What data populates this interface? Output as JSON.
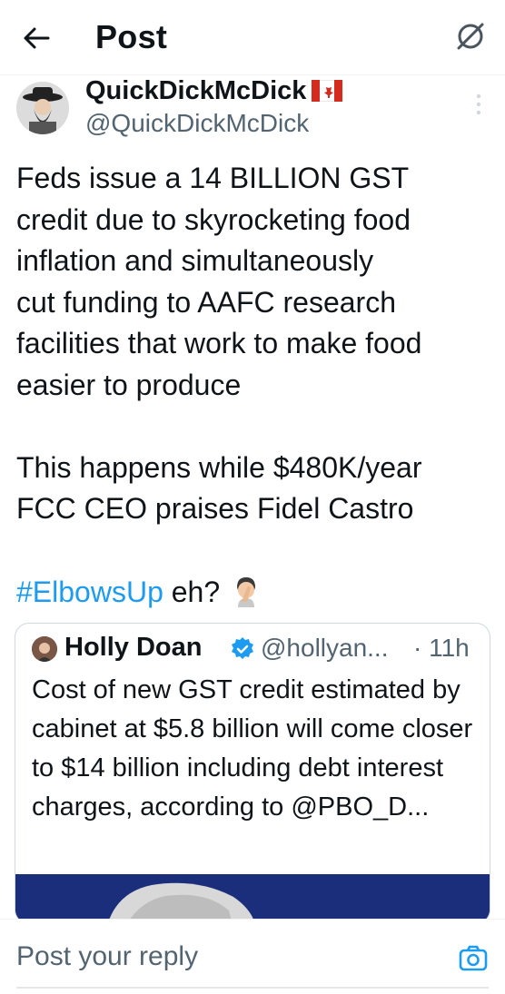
{
  "header": {
    "title": "Post"
  },
  "post": {
    "author_name": "QuickDickMcDick",
    "author_handle": "@QuickDickMcDick",
    "text": "Feds issue a 14 BILLION GST\ncredit due to skyrocketing food\ninflation and simultaneously\ncut funding to AAFC research\nfacilities that work to make food\neasier to produce\n\nThis happens while $480K/year\nFCC CEO praises Fidel Castro",
    "hashtag": "#ElbowsUp",
    "tag_suffix": "eh?"
  },
  "quote": {
    "author_name": "Holly Doan",
    "author_handle": "@hollyan...",
    "time": "· 11h",
    "text": "Cost of new GST credit estimated by cabinet at $5.8 billion will come closer to $14 billion including debt interest charges, according to @PBO_D..."
  },
  "reply": {
    "placeholder": "Post your reply"
  },
  "colors": {
    "accent": "#1d9bf0",
    "muted": "#536471",
    "text": "#0f1419"
  },
  "icons": [
    "back-arrow-icon",
    "grok-icon",
    "canada-flag-icon",
    "more-vertical-icon",
    "facepalm-emoji-icon",
    "verified-badge-icon",
    "camera-icon"
  ]
}
